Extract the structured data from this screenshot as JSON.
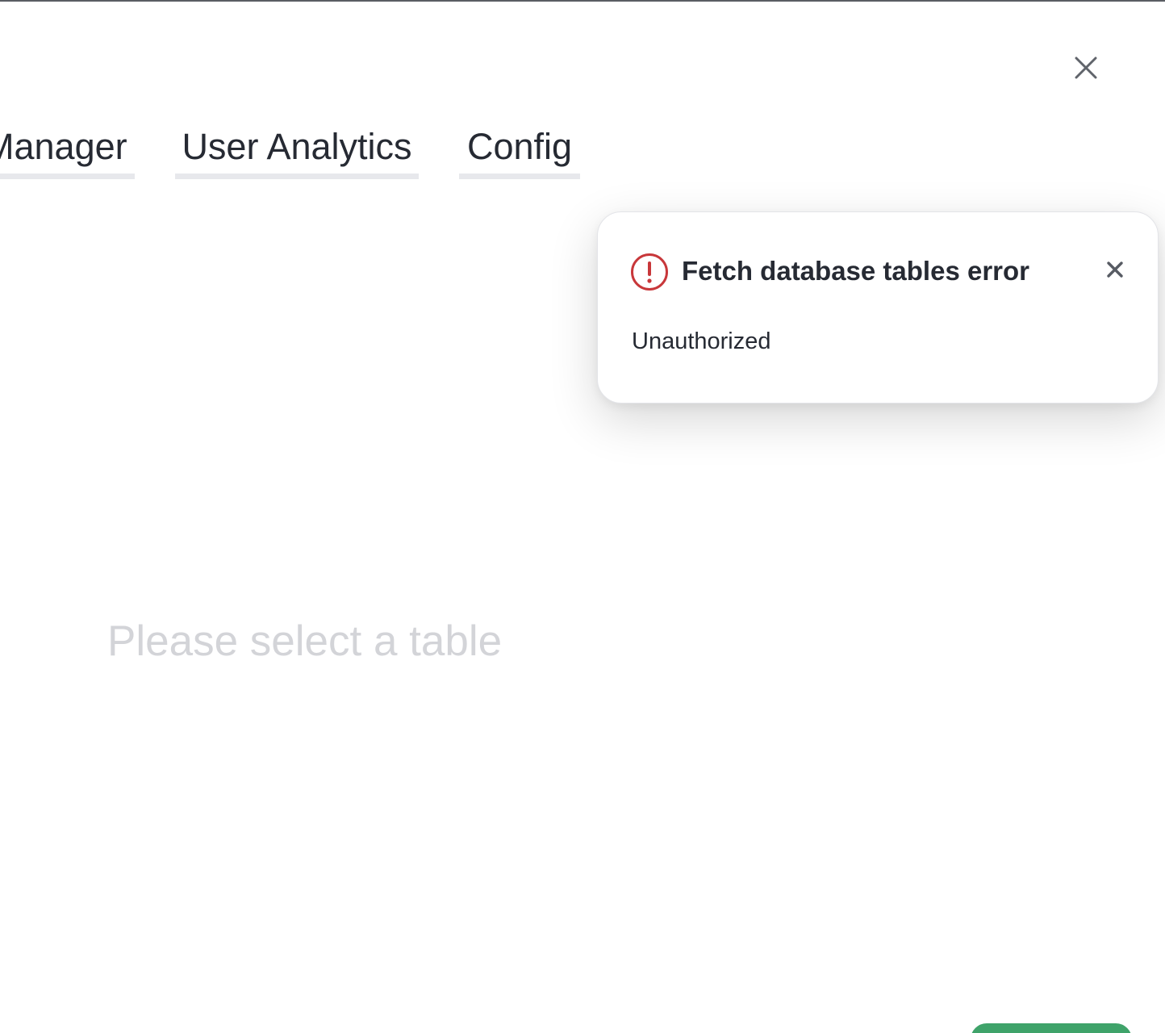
{
  "tabs": [
    {
      "label": "Manager"
    },
    {
      "label": "User Analytics"
    },
    {
      "label": "Config"
    }
  ],
  "toast": {
    "title": "Fetch database tables error",
    "message": "Unauthorized",
    "icon": "error-circle-icon",
    "accent_color": "#c8373a"
  },
  "main": {
    "placeholder": "Please select a table"
  },
  "icons": {
    "modal_close": "close-icon",
    "toast_close": "close-icon"
  },
  "colors": {
    "primary_button": "#3fa36a",
    "text": "#262a33",
    "muted_text": "#d3d4d8"
  }
}
